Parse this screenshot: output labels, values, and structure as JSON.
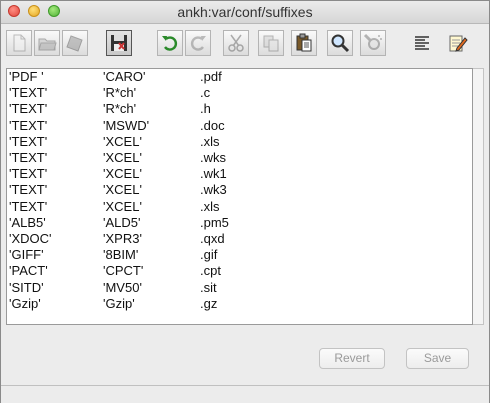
{
  "window": {
    "title": "ankh:var/conf/suffixes"
  },
  "toolbar": {
    "buttons": [
      {
        "name": "new-icon",
        "enabled": false
      },
      {
        "name": "open-icon",
        "enabled": false
      },
      {
        "name": "close-doc-icon",
        "enabled": false
      },
      {
        "name": "save-floppy-icon",
        "enabled": true,
        "selected": true
      },
      {
        "name": "undo-icon",
        "enabled": true
      },
      {
        "name": "redo-icon",
        "enabled": false
      },
      {
        "name": "cut-icon",
        "enabled": false
      },
      {
        "name": "copy-icon",
        "enabled": false
      },
      {
        "name": "paste-icon",
        "enabled": true
      },
      {
        "name": "find-icon",
        "enabled": true
      },
      {
        "name": "find-next-icon",
        "enabled": false
      },
      {
        "name": "align-left-icon",
        "enabled": true
      },
      {
        "name": "edit-note-icon",
        "enabled": true
      }
    ]
  },
  "rows": [
    [
      "'PDF '",
      "'CARO'",
      ".pdf"
    ],
    [
      "'TEXT'",
      "'R*ch'",
      ".c"
    ],
    [
      "'TEXT'",
      "'R*ch'",
      ".h"
    ],
    [
      "'TEXT'",
      "'MSWD'",
      ".doc"
    ],
    [
      "'TEXT'",
      "'XCEL'",
      ".xls"
    ],
    [
      "'TEXT'",
      "'XCEL'",
      ".wks"
    ],
    [
      "'TEXT'",
      "'XCEL'",
      ".wk1"
    ],
    [
      "'TEXT'",
      "'XCEL'",
      ".wk3"
    ],
    [
      "'TEXT'",
      "'XCEL'",
      ".xls"
    ],
    [
      "'ALB5'",
      "'ALD5'",
      ".pm5"
    ],
    [
      "'XDOC'",
      "'XPR3'",
      ".qxd"
    ],
    [
      "'GIFF'",
      "'8BIM'",
      ".gif"
    ],
    [
      "'PACT'",
      "'CPCT'",
      ".cpt"
    ],
    [
      "'SITD'",
      "'MV50'",
      ".sit"
    ],
    [
      "'Gzip'",
      "'Gzip'",
      ".gz"
    ]
  ],
  "buttons": {
    "revert": "Revert",
    "save": "Save"
  }
}
